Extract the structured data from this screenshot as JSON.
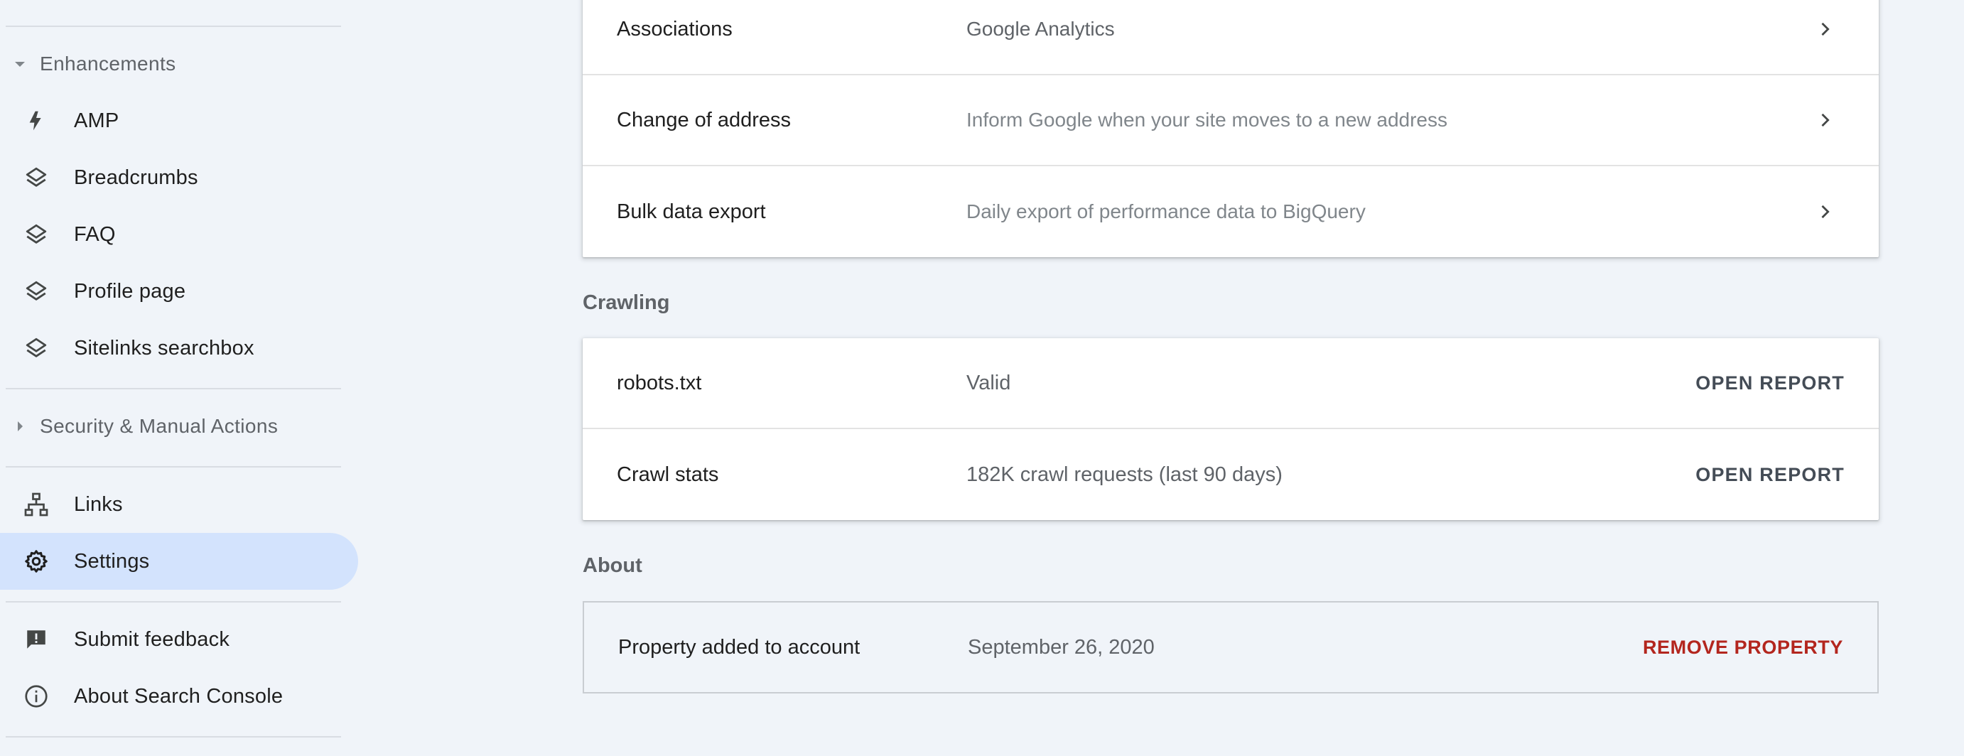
{
  "sidebar": {
    "enhancements": {
      "label": "Enhancements",
      "items": [
        {
          "label": "AMP",
          "icon": "bolt-icon"
        },
        {
          "label": "Breadcrumbs",
          "icon": "layers-icon"
        },
        {
          "label": "FAQ",
          "icon": "layers-icon"
        },
        {
          "label": "Profile page",
          "icon": "layers-icon"
        },
        {
          "label": "Sitelinks searchbox",
          "icon": "layers-icon"
        }
      ]
    },
    "security": {
      "label": "Security & Manual Actions"
    },
    "links": {
      "label": "Links",
      "icon": "sitemap-icon"
    },
    "settings": {
      "label": "Settings",
      "icon": "gear-icon",
      "active": true
    },
    "feedback": {
      "label": "Submit feedback",
      "icon": "feedback-icon"
    },
    "about": {
      "label": "About Search Console",
      "icon": "info-icon"
    }
  },
  "general": {
    "rows": [
      {
        "title": "Associations",
        "desc": "Google Analytics"
      },
      {
        "title": "Change of address",
        "desc": "Inform Google when your site moves to a new address"
      },
      {
        "title": "Bulk data export",
        "desc": "Daily export of performance data to BigQuery"
      }
    ]
  },
  "crawling": {
    "label": "Crawling",
    "rows": [
      {
        "title": "robots.txt",
        "desc": "Valid",
        "action": "OPEN REPORT"
      },
      {
        "title": "Crawl stats",
        "desc": "182K crawl requests (last 90 days)",
        "action": "OPEN REPORT"
      }
    ]
  },
  "about": {
    "label": "About",
    "title": "Property added to account",
    "date": "September 26, 2020",
    "action": "REMOVE PROPERTY"
  },
  "colors": {
    "background": "#f0f4f9",
    "active_nav": "#d3e3fd",
    "remove_action": "#b3261e",
    "open_report": "#444c56"
  }
}
